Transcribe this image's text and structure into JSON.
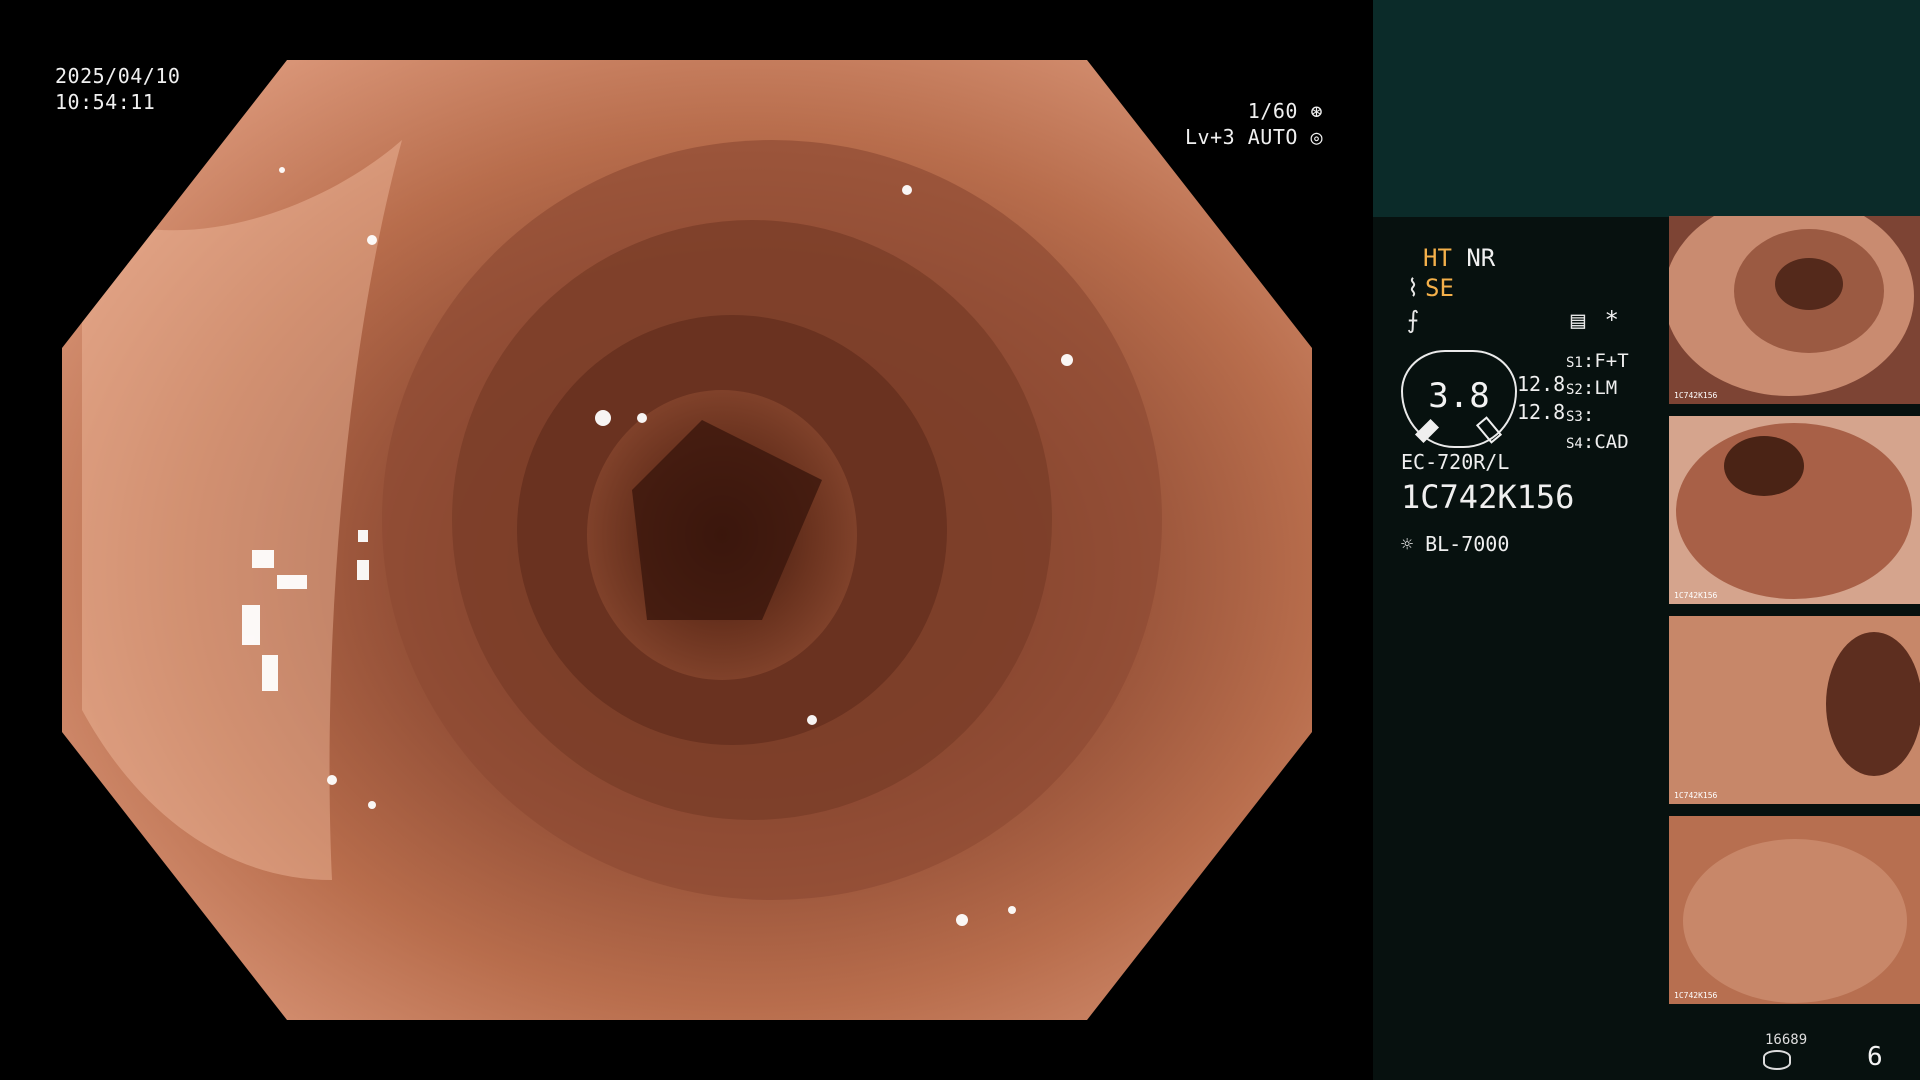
{
  "overlay": {
    "date": "2025/04/10",
    "time": "10:54:11",
    "shutter": "1/60",
    "level": "Lv+3",
    "mode": "AUTO"
  },
  "panel": {
    "ht": "HT",
    "nr": "NR",
    "se": "SE",
    "asterisk": "*",
    "dial_value": "3.8",
    "zoom_a": "12.8",
    "zoom_b": "12.8",
    "s1_key": "S1",
    "s1_value": "F+T",
    "s2_key": "S2",
    "s2_value": "LM",
    "s3_key": "S3",
    "s3_value": "",
    "s4_key": "S4",
    "s4_value": "CAD",
    "scope_model": "EC-720R/L",
    "serial": "1C742K156",
    "light_source": "BL-7000",
    "storage_count": "16689",
    "page": "6"
  },
  "thumbnails": [
    {
      "label": "1C742K156"
    },
    {
      "label": "1C742K156"
    },
    {
      "label": "1C742K156"
    },
    {
      "label": "1C742K156"
    }
  ],
  "colors": {
    "header_bg": "#0b2b29",
    "panel_bg": "#07110f",
    "accent": "#f4b04a"
  }
}
